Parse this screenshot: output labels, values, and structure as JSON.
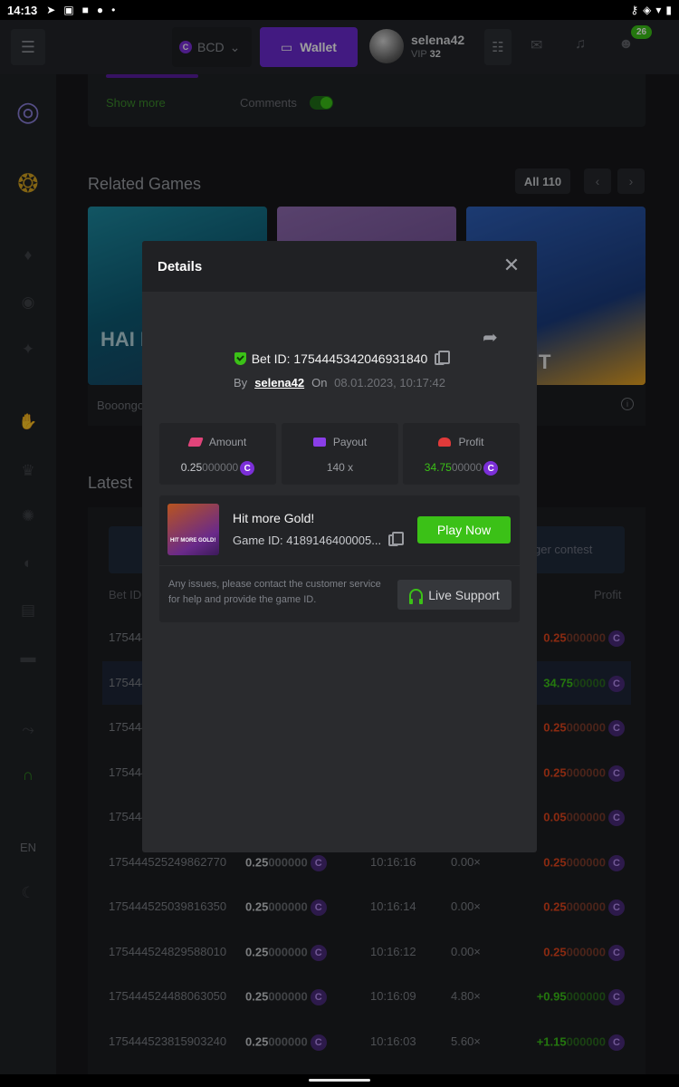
{
  "status_bar": {
    "time": "14:13"
  },
  "header": {
    "currency": "BCD",
    "wallet_label": "Wallet",
    "username": "selena42",
    "vip_prefix": "VIP",
    "vip_level": "32",
    "chat_badge": "26"
  },
  "sidebar": {
    "language": "EN"
  },
  "background": {
    "show_more": "Show more",
    "comments": "Comments",
    "related_title": "Related Games",
    "related_all": "All 110",
    "tile_texts": [
      "HAI FISH",
      "",
      "T"
    ],
    "provider": "Booongo",
    "latest_title": "Latest",
    "contest_label": "ger contest",
    "col_betid": "Bet ID",
    "col_profit": "Profit",
    "rows": [
      {
        "id": "175444",
        "amount": "",
        "amount_dim": "",
        "time": "",
        "mult": "",
        "profit": "0.25",
        "profit_dim": "000000",
        "kind": "red"
      },
      {
        "id": "175444",
        "amount": "",
        "amount_dim": "",
        "time": "",
        "mult": "",
        "profit": "34.75",
        "profit_dim": "00000",
        "kind": "green"
      },
      {
        "id": "175444",
        "amount": "",
        "amount_dim": "",
        "time": "",
        "mult": "",
        "profit": "0.25",
        "profit_dim": "000000",
        "kind": "red"
      },
      {
        "id": "175444",
        "amount": "",
        "amount_dim": "",
        "time": "",
        "mult": "",
        "profit": "0.25",
        "profit_dim": "000000",
        "kind": "red"
      },
      {
        "id": "175444",
        "amount": "",
        "amount_dim": "",
        "time": "",
        "mult": "",
        "profit": "0.05",
        "profit_dim": "000000",
        "kind": "red"
      },
      {
        "id": "175444525249862770",
        "amount": "0.25",
        "amount_dim": "000000",
        "time": "10:16:16",
        "mult": "0.00×",
        "profit": "0.25",
        "profit_dim": "000000",
        "kind": "red"
      },
      {
        "id": "175444525039816350",
        "amount": "0.25",
        "amount_dim": "000000",
        "time": "10:16:14",
        "mult": "0.00×",
        "profit": "0.25",
        "profit_dim": "000000",
        "kind": "red"
      },
      {
        "id": "175444524829588010",
        "amount": "0.25",
        "amount_dim": "000000",
        "time": "10:16:12",
        "mult": "0.00×",
        "profit": "0.25",
        "profit_dim": "000000",
        "kind": "red"
      },
      {
        "id": "175444524488063050",
        "amount": "0.25",
        "amount_dim": "000000",
        "time": "10:16:09",
        "mult": "4.80×",
        "profit": "+0.95",
        "profit_dim": "000000",
        "kind": "green"
      },
      {
        "id": "175444523815903240",
        "amount": "0.25",
        "amount_dim": "000000",
        "time": "10:16:03",
        "mult": "5.60×",
        "profit": "+1.15",
        "profit_dim": "000000",
        "kind": "green"
      }
    ]
  },
  "modal": {
    "title": "Details",
    "bet_id_label": "Bet ID:",
    "bet_id": "1754445342046931840",
    "by_label": "By",
    "user": "selena42",
    "on_label": "On",
    "date": "08.01.2023, 10:17:42",
    "amount_label": "Amount",
    "amount": "0.25",
    "amount_dim": "000000",
    "payout_label": "Payout",
    "payout": "140 x",
    "profit_label": "Profit",
    "profit": "34.75",
    "profit_dim": "00000",
    "game_title": "Hit more Gold!",
    "game_id_label": "Game ID:",
    "game_id": "4189146400005...",
    "thumb_text": "HIT MORE GOLD!",
    "play_label": "Play Now",
    "issue_text": "Any issues, please contact the customer service for help and provide the game ID.",
    "support_label": "Live Support"
  },
  "colors": {
    "accent_green": "#3bc117",
    "wallet_purple": "#6b2bd1",
    "coin_purple": "#7b2fd8",
    "loss_red": "#e0441c"
  },
  "icons": [
    "menu-icon",
    "wallet-icon",
    "transactions-icon",
    "mail-icon",
    "bell-icon",
    "chat-icon",
    "close-icon",
    "share-icon",
    "shield-check-icon",
    "copy-icon",
    "headset-icon"
  ]
}
